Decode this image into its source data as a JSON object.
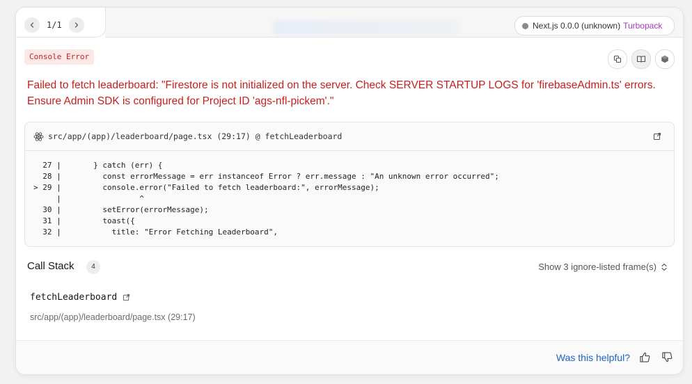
{
  "nav": {
    "prev_icon": "chevron-left-icon",
    "next_icon": "chevron-right-icon",
    "pager": "1/1"
  },
  "version": {
    "label": "Next.js 0.0.0 (unknown)",
    "bundler": "Turbopack",
    "bundler_color": "#a53ab8"
  },
  "error": {
    "badge": "Console Error",
    "message": "Failed to fetch leaderboard: \"Firestore is not initialized on the server. Check SERVER STARTUP LOGS for 'firebaseAdmin.ts' errors. Ensure Admin SDK is configured for Project ID 'ags-nfl-pickem'.\"",
    "color": "#c81e1e"
  },
  "actions": {
    "copy_icon": "copy-icon",
    "docs_icon": "book-icon",
    "nextjs_icon": "nextjs-logo-icon"
  },
  "code": {
    "location": "src/app/(app)/leaderboard/page.tsx (29:17) @ fetchLeaderboard",
    "lines": [
      "  27 |       } catch (err) {",
      "  28 |         const errorMessage = err instanceof Error ? err.message : \"An unknown error occurred\";",
      "> 29 |         console.error(\"Failed to fetch leaderboard:\", errorMessage);",
      "     |                 ^",
      "  30 |         setError(errorMessage);",
      "  31 |         toast({",
      "  32 |           title: \"Error Fetching Leaderboard\","
    ]
  },
  "call_stack": {
    "title": "Call Stack",
    "count": "4",
    "show_ignored": "Show 3 ignore-listed frame(s)",
    "frames": [
      {
        "fn": "fetchLeaderboard",
        "file": "src/app/(app)/leaderboard/page.tsx (29:17)"
      }
    ]
  },
  "footer": {
    "helpful": "Was this helpful?",
    "thumbs_up_icon": "thumbs-up-icon",
    "thumbs_down_icon": "thumbs-down-icon"
  }
}
